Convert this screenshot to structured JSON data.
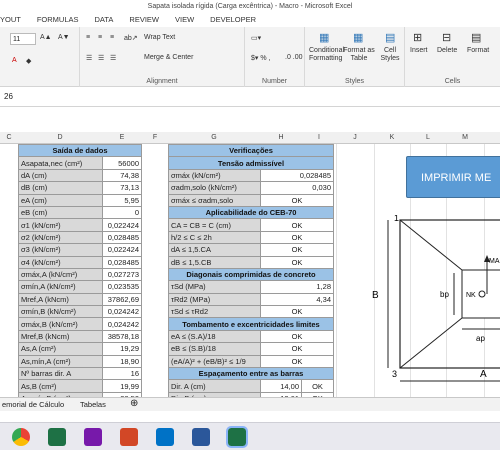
{
  "window": {
    "title": "Sapata isolada rígida (Carga excêntrica) - Macro - Microsoft Excel"
  },
  "ribbon_tabs": [
    "YOUT",
    "FORMULAS",
    "DATA",
    "REVIEW",
    "VIEW",
    "DEVELOPER"
  ],
  "ribbon": {
    "font_size": "11",
    "wrap_text": "Wrap Text",
    "merge_center": "Merge & Center",
    "alignment_label": "Alignment",
    "number_label": "Number",
    "styles_label": "Styles",
    "cells_label": "Cells",
    "conditional_formatting": "Conditional Formatting",
    "format_as_table": "Format as Table",
    "cell_styles": "Cell Styles",
    "insert": "Insert",
    "delete": "Delete",
    "format": "Format"
  },
  "formula_bar": {
    "value": "26"
  },
  "columns": [
    "C",
    "D",
    "E",
    "F",
    "G",
    "H",
    "I",
    "J",
    "K",
    "L",
    "M"
  ],
  "saida": {
    "header": "Saída de dados",
    "rows": [
      {
        "label": "Asapata,nec (cm²)",
        "value": "56000"
      },
      {
        "label": "dA (cm)",
        "value": "74,38"
      },
      {
        "label": "dB (cm)",
        "value": "73,13"
      },
      {
        "label": "eA (cm)",
        "value": "5,95"
      },
      {
        "label": "eB (cm)",
        "value": "0"
      },
      {
        "label": "σ1 (kN/cm²)",
        "value": "0,022424"
      },
      {
        "label": "σ2 (kN/cm²)",
        "value": "0,028485"
      },
      {
        "label": "σ3 (kN/cm²)",
        "value": "0,022424"
      },
      {
        "label": "σ4 (kN/cm²)",
        "value": "0,028485"
      },
      {
        "label": "σmáx,A (kN/cm²)",
        "value": "0,027273"
      },
      {
        "label": "σmín,A (kN/cm²)",
        "value": "0,023535"
      },
      {
        "label": "Mref,A (kNcm)",
        "value": "37862,69"
      },
      {
        "label": "σmín,B (kN/cm²)",
        "value": "0,024242"
      },
      {
        "label": "σmáx,B (kN/cm²)",
        "value": "0,024242"
      },
      {
        "label": "Mref,B (kNcm)",
        "value": "38578,18"
      },
      {
        "label": "As,A (cm²)",
        "value": "19,29"
      },
      {
        "label": "As,mín,A (cm²)",
        "value": "18,90"
      },
      {
        "label": "Nº barras dir. A",
        "value": "16"
      },
      {
        "label": "As,B (cm²)",
        "value": "19,99"
      },
      {
        "label": "As,mín,B (cm²)",
        "value": "28,50"
      }
    ]
  },
  "verif": {
    "header": "Verificações",
    "sections": [
      {
        "title": "Tensão admissível",
        "rows": [
          {
            "label": "σmáx (kN/cm²)",
            "value": "0,028485"
          },
          {
            "label": "σadm,solo (kN/cm²)",
            "value": "0,030"
          },
          {
            "label": "σmáx ≤ σadm,solo",
            "value": "OK"
          }
        ]
      },
      {
        "title": "Aplicabilidade do CEB-70",
        "rows": [
          {
            "label": "CA = CB = C (cm)",
            "value": "OK"
          },
          {
            "label": "h/2 ≤ C ≤ 2h",
            "value": "OK"
          },
          {
            "label": "dA ≤ 1,5.CA",
            "value": "OK"
          },
          {
            "label": "dB ≤ 1,5.CB",
            "value": "OK"
          }
        ]
      },
      {
        "title": "Diagonais comprimidas de concreto",
        "rows": [
          {
            "label": "τSd (MPa)",
            "value": "1,28"
          },
          {
            "label": "τRd2 (MPa)",
            "value": "4,34"
          },
          {
            "label": "τSd ≤ τRd2",
            "value": "OK"
          }
        ]
      },
      {
        "title": "Tombamento e excentricidades limites",
        "rows": [
          {
            "label": "eA ≤ (S.A)/18",
            "value": "OK"
          },
          {
            "label": "eB ≤ (S.B)/18",
            "value": "OK"
          },
          {
            "label": "(eA/A)² + (eB/B)² ≤ 1/9",
            "value": "OK"
          }
        ]
      },
      {
        "title": "Espaçamento entre as barras",
        "rows": [
          {
            "label": "Dir. A (cm)",
            "value": "14,00",
            "status": "OK"
          },
          {
            "label": "Dir. B (cm)",
            "value": "12,61",
            "status": "OK"
          }
        ]
      }
    ]
  },
  "button": {
    "label": "IMPRIMIR ME"
  },
  "diagram": {
    "corner1": "1",
    "corner3": "3",
    "side_b": "B",
    "side_a": "A",
    "bp": "bp",
    "ap": "ap",
    "nk": "NK",
    "ma": "MA"
  },
  "sheet_tabs": [
    "emorial de Cálculo",
    "Tabelas"
  ],
  "colors": {
    "header_blue": "#9bc2e6",
    "button_blue": "#5b9bd5",
    "label_gray": "#d9d9d9"
  }
}
